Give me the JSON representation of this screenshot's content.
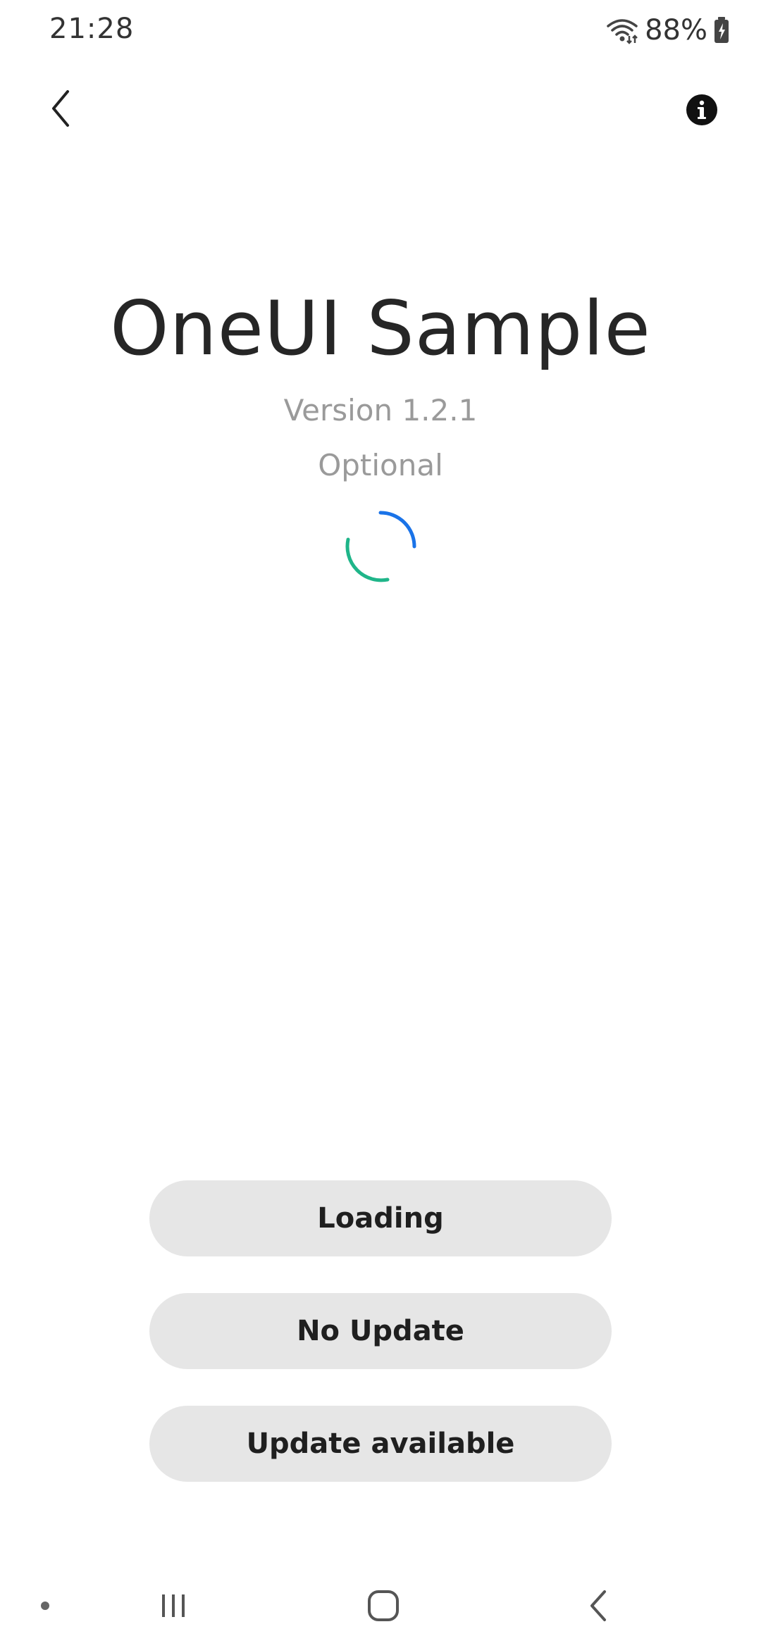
{
  "status_bar": {
    "time": "21:28",
    "battery": "88%",
    "icons": [
      "wifi-icon",
      "battery-charging-icon"
    ]
  },
  "app_bar": {
    "back_icon": "chevron-left-icon",
    "info_icon": "info-icon"
  },
  "main": {
    "title": "OneUI Sample",
    "version": "Version 1.2.1",
    "update_type": "Optional",
    "spinner_colors": [
      "#1a73e8",
      "#1fb589"
    ]
  },
  "buttons": {
    "loading_label": "Loading",
    "no_update_label": "No Update",
    "update_available_label": "Update available"
  },
  "nav_bar": {
    "items": [
      "dot-indicator-icon",
      "recents-icon",
      "home-icon",
      "back-icon"
    ]
  },
  "colors": {
    "button_bg": "#e6e6e6",
    "secondary_text": "#9a9a9a",
    "title_text": "#262626"
  }
}
